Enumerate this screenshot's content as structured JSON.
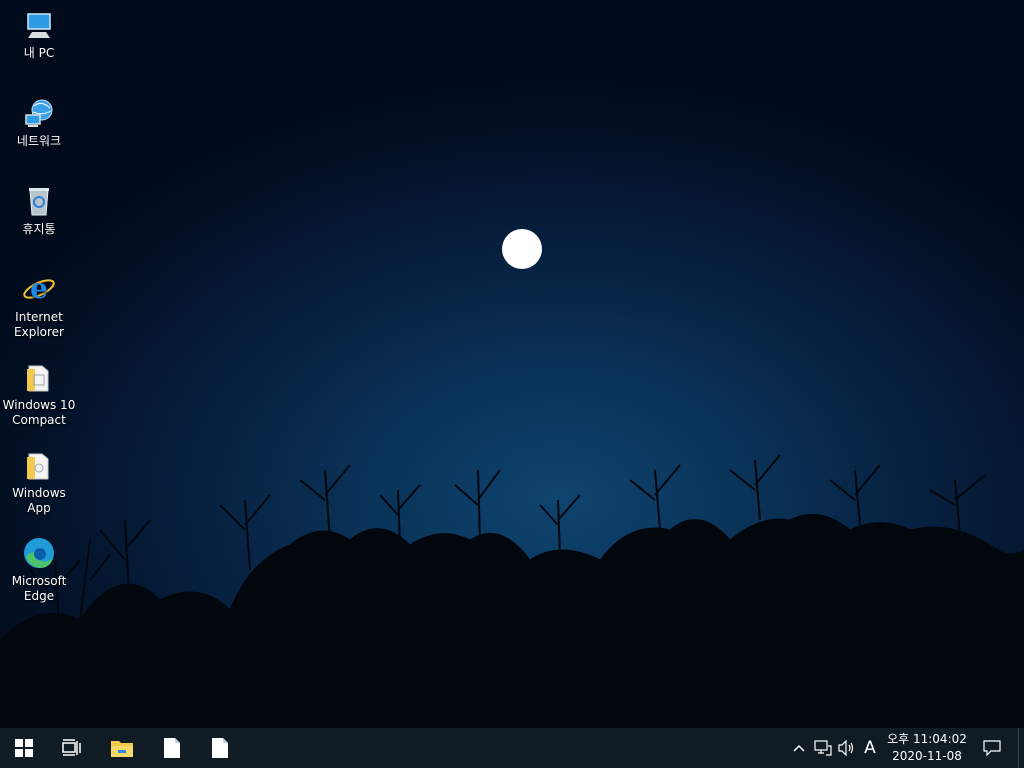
{
  "desktop": {
    "icons": [
      {
        "label": "내 PC",
        "icon": "computer-icon"
      },
      {
        "label": "네트워크",
        "icon": "network-icon"
      },
      {
        "label": "휴지통",
        "icon": "recycle-bin-icon"
      },
      {
        "label": "Internet\nExplorer",
        "icon": "internet-explorer-icon"
      },
      {
        "label": "Windows 10\nCompact",
        "icon": "folder-icon"
      },
      {
        "label": "Windows\nApp",
        "icon": "folder-icon"
      },
      {
        "label": "Microsoft\nEdge",
        "icon": "edge-icon"
      }
    ]
  },
  "taskbar": {
    "buttons": [
      {
        "icon": "windows-start-icon"
      },
      {
        "icon": "task-view-icon"
      },
      {
        "icon": "file-explorer-icon"
      },
      {
        "icon": "document-icon"
      },
      {
        "icon": "document-icon"
      }
    ],
    "tray": {
      "icons": [
        "chevron-up-icon",
        "network-icon",
        "volume-icon"
      ],
      "ime": "A"
    },
    "clock": {
      "time": "오후 11:04:02",
      "date": "2020-11-08"
    },
    "notification_icon": "action-center-icon"
  },
  "colors": {
    "taskbar_bg": "#101b24",
    "sky_center": "#0e4470",
    "sky_edge": "#020b1c"
  }
}
